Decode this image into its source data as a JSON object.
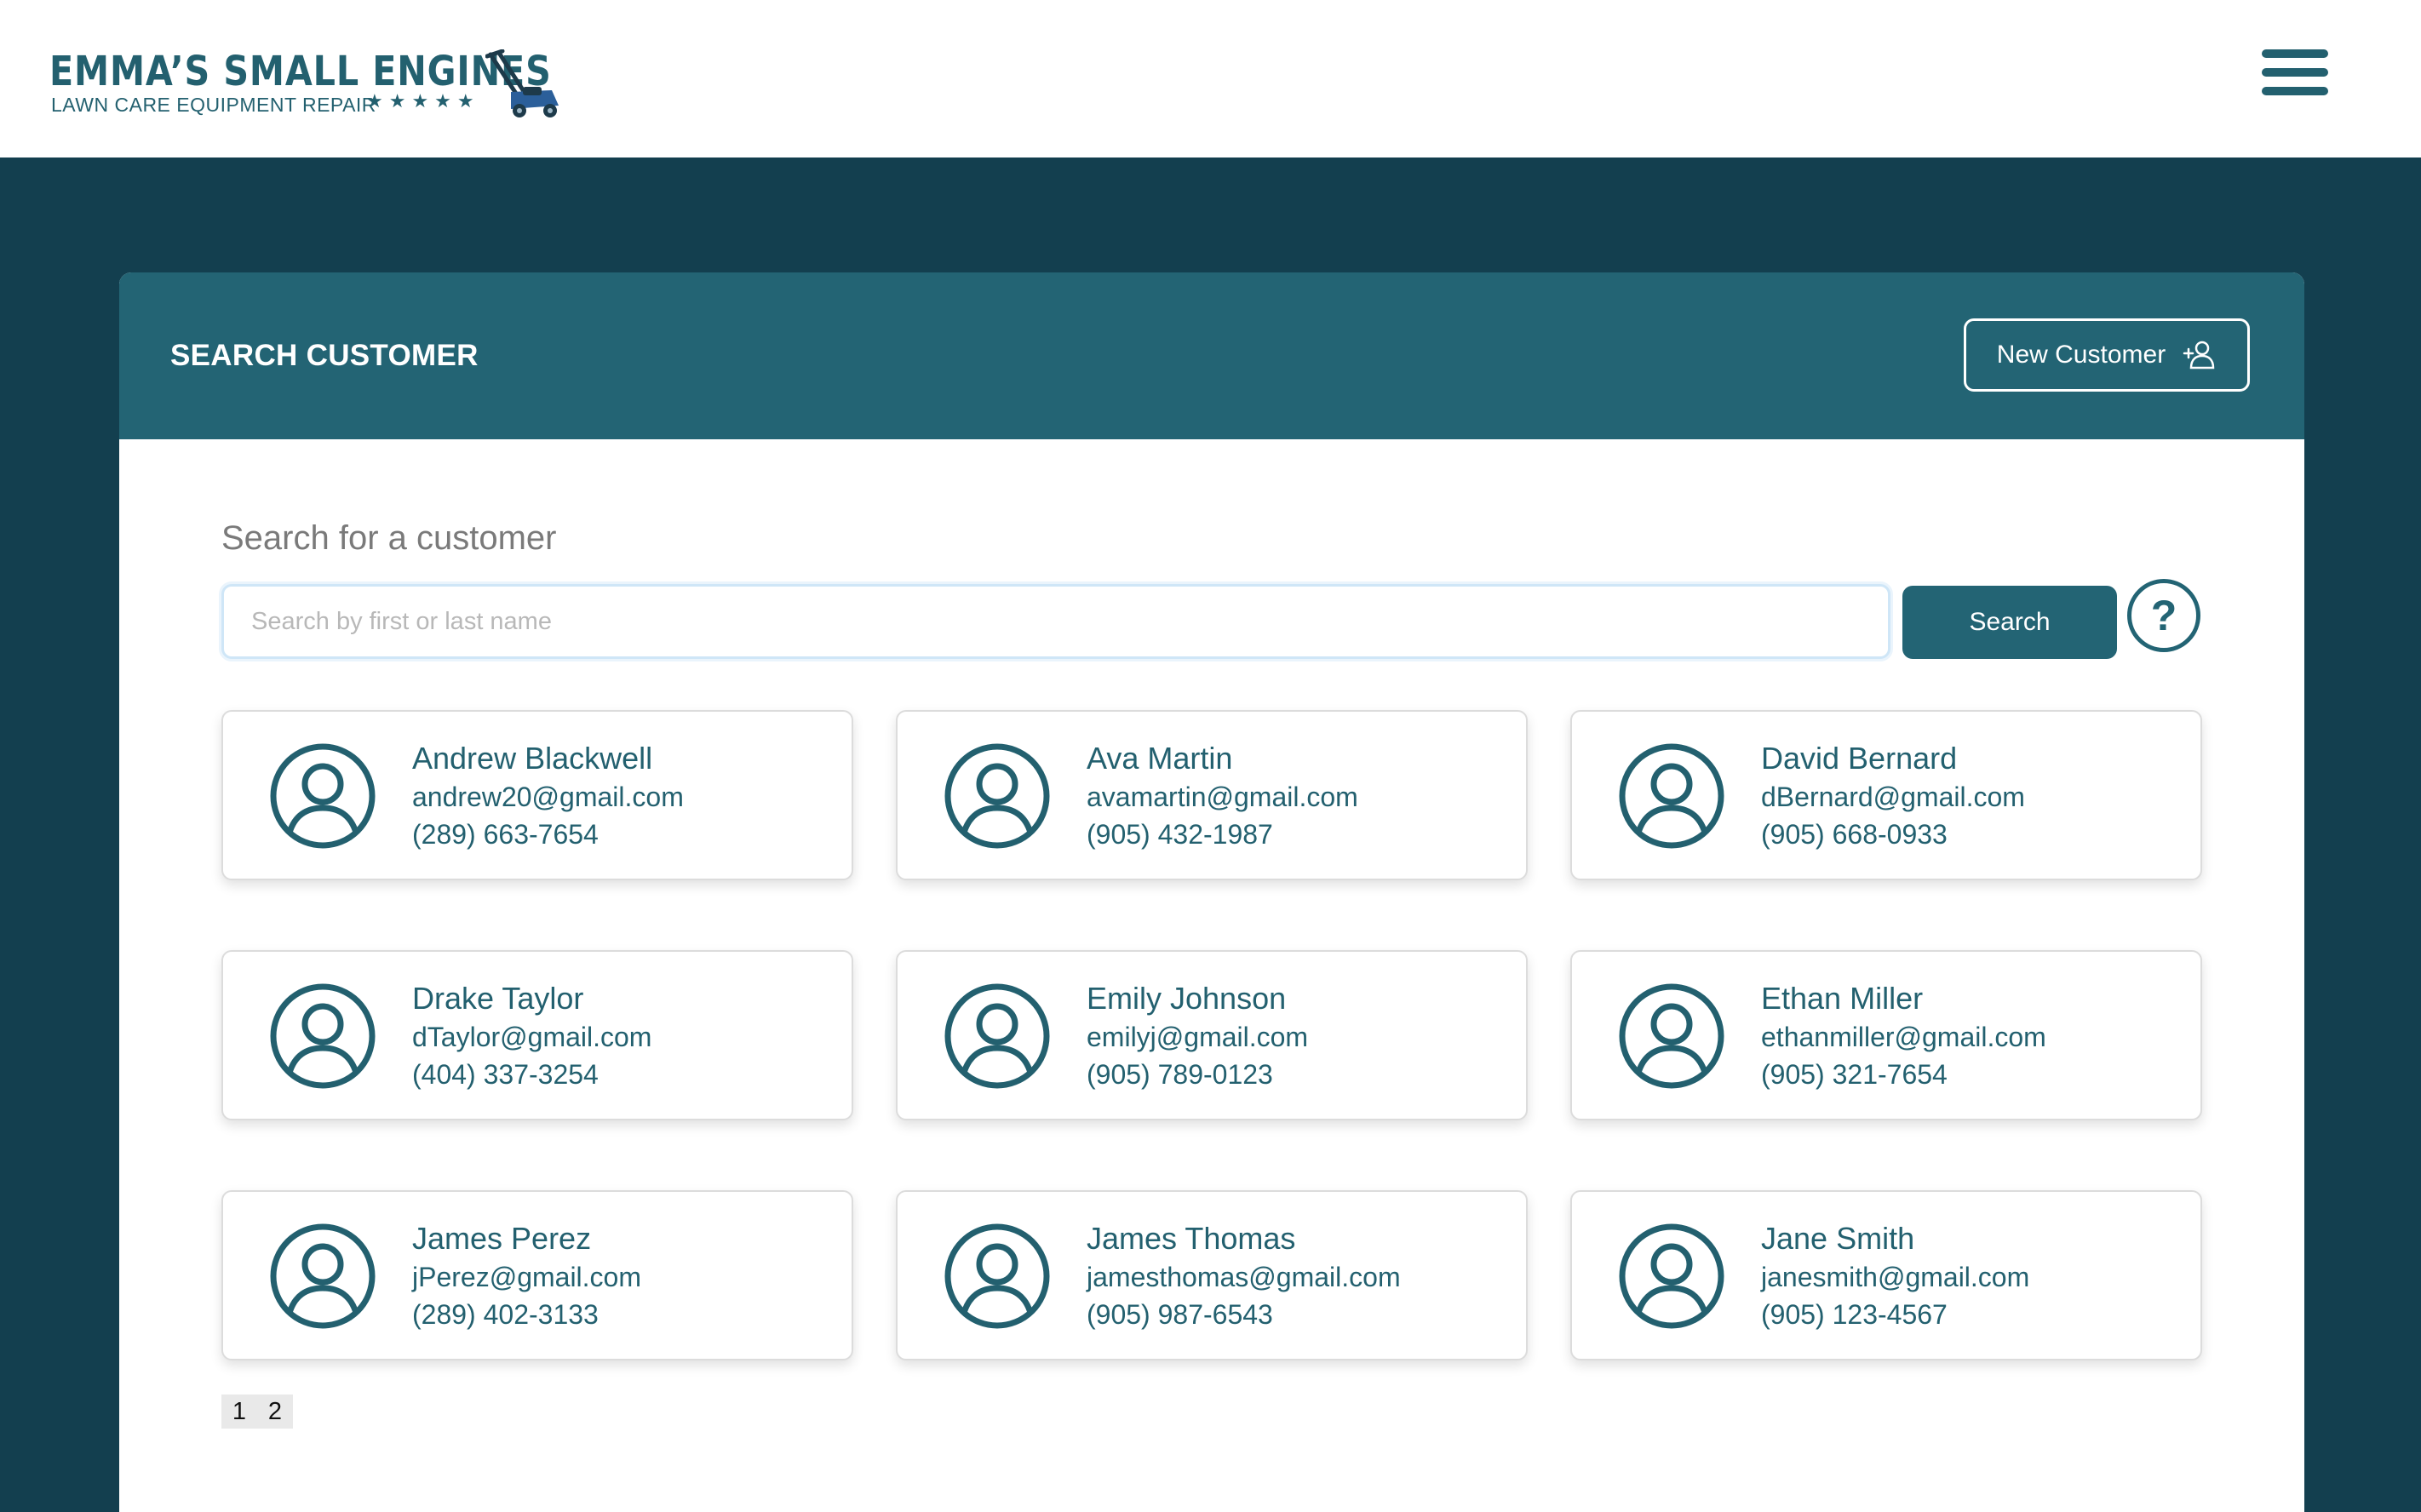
{
  "header": {
    "logo_title": "EMMA’S SMALL ENGINES",
    "logo_subtitle": "LAWN CARE EQUIPMENT REPAIR",
    "logo_stars": "★★★★★",
    "menu_icon": "hamburger-icon"
  },
  "panel": {
    "title": "SEARCH CUSTOMER",
    "new_customer_label": "New Customer",
    "new_customer_icon": "user-plus-icon"
  },
  "search": {
    "label": "Search for a customer",
    "placeholder": "Search by first or last name",
    "value": "",
    "button_label": "Search",
    "help_label": "?"
  },
  "customers": [
    {
      "name": "Andrew Blackwell",
      "email": "andrew20@gmail.com",
      "phone": "(289) 663-7654"
    },
    {
      "name": "Ava Martin",
      "email": "avamartin@gmail.com",
      "phone": "(905) 432-1987"
    },
    {
      "name": "David Bernard",
      "email": "dBernard@gmail.com",
      "phone": "(905) 668-0933"
    },
    {
      "name": "Drake Taylor",
      "email": "dTaylor@gmail.com",
      "phone": "(404) 337-3254"
    },
    {
      "name": "Emily Johnson",
      "email": "emilyj@gmail.com",
      "phone": "(905) 789-0123"
    },
    {
      "name": "Ethan Miller",
      "email": "ethanmiller@gmail.com",
      "phone": "(905) 321-7654"
    },
    {
      "name": "James Perez",
      "email": "jPerez@gmail.com",
      "phone": "(289) 402-3133"
    },
    {
      "name": "James Thomas",
      "email": "jamesthomas@gmail.com",
      "phone": "(905) 987-6543"
    },
    {
      "name": "Jane Smith",
      "email": "janesmith@gmail.com",
      "phone": "(905) 123-4567"
    }
  ],
  "pagination": {
    "pages": [
      "1",
      "2"
    ]
  },
  "colors": {
    "background": "#133f4f",
    "accent": "#236474",
    "text_primary": "#23606f"
  }
}
